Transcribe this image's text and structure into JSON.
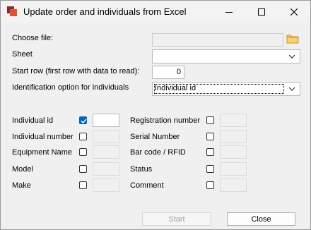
{
  "window": {
    "title": "Update order and individuals from Excel"
  },
  "form": {
    "choose_file_label": "Choose file:",
    "file_path": "",
    "sheet_label": "Sheet",
    "sheet_value": "",
    "start_row_label": "Start row (first row with data to read):",
    "start_row_value": "0",
    "ident_label": "Identification option for individuals",
    "ident_value": "Individual id"
  },
  "fields_left": [
    {
      "label": "Individual id",
      "checked": true,
      "value": ""
    },
    {
      "label": "Individual number",
      "checked": false,
      "value": ""
    },
    {
      "label": "Equipment Name",
      "checked": false,
      "value": ""
    },
    {
      "label": "Model",
      "checked": false,
      "value": ""
    },
    {
      "label": "Make",
      "checked": false,
      "value": ""
    }
  ],
  "fields_right": [
    {
      "label": "Registration number",
      "checked": false,
      "value": ""
    },
    {
      "label": "Serial Number",
      "checked": false,
      "value": ""
    },
    {
      "label": "Bar code / RFID",
      "checked": false,
      "value": ""
    },
    {
      "label": "Status",
      "checked": false,
      "value": ""
    },
    {
      "label": "Comment",
      "checked": false,
      "value": ""
    }
  ],
  "buttons": {
    "start": "Start",
    "close": "Close"
  },
  "colors": {
    "accent": "#0067c0",
    "folder": "#f2c24c"
  },
  "icons": {
    "app": "app-icon",
    "minimize": "minimize-icon",
    "maximize": "maximize-icon",
    "close": "close-icon",
    "folder": "folder-icon",
    "dropdown": "chevron-down-icon",
    "check": "checkmark-icon"
  }
}
